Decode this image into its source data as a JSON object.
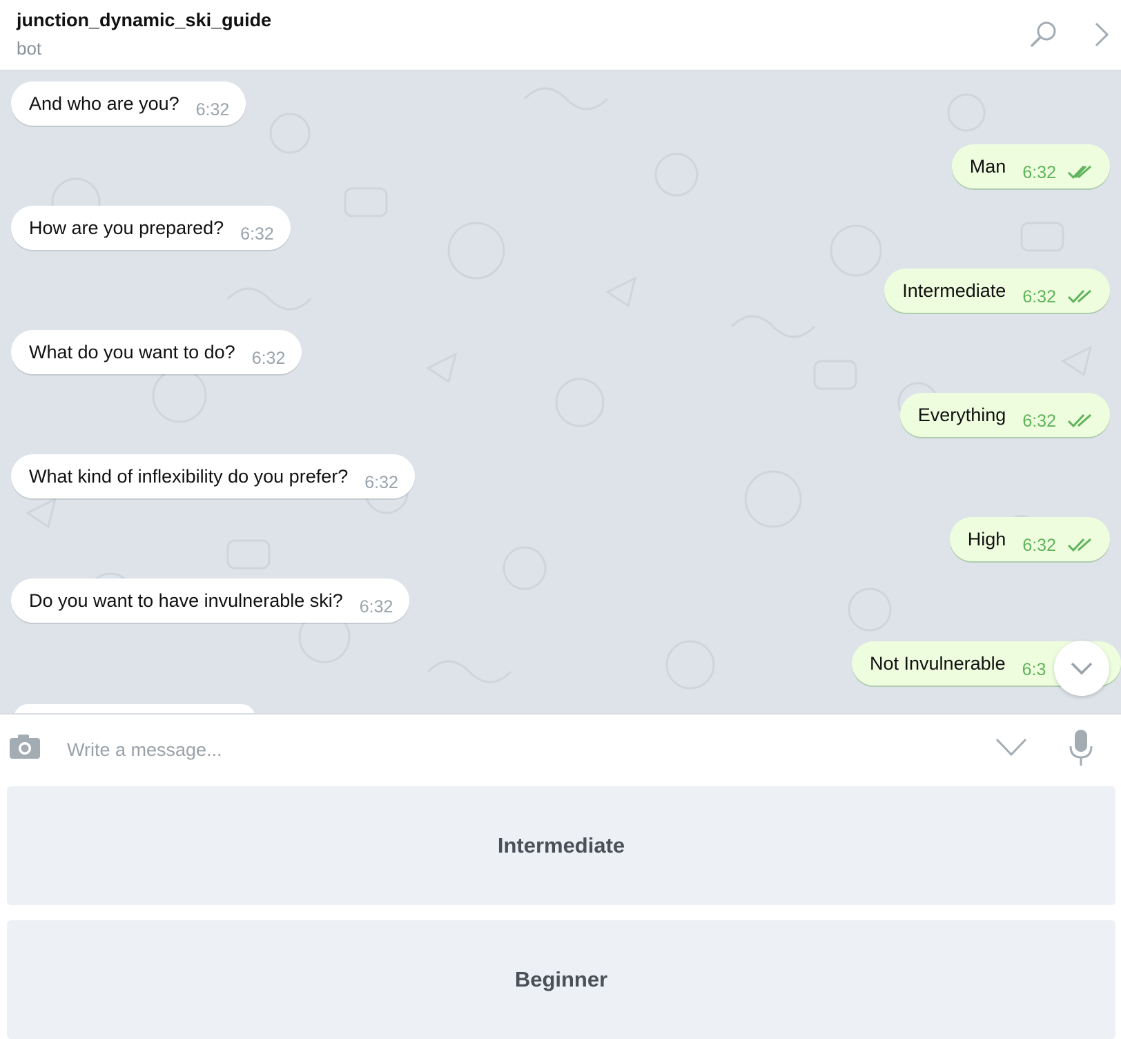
{
  "header": {
    "title": "junction_dynamic_ski_guide",
    "subtitle": "bot",
    "search_icon": "search-icon",
    "more_icon": "chevron-right-icon"
  },
  "messages": [
    {
      "direction": "in",
      "text": "And who are you?",
      "time": "6:32"
    },
    {
      "direction": "out",
      "text": "Man",
      "time": "6:32",
      "status": "read"
    },
    {
      "direction": "in",
      "text": "How are you prepared?",
      "time": "6:32"
    },
    {
      "direction": "out",
      "text": "Intermediate",
      "time": "6:32",
      "status": "read"
    },
    {
      "direction": "in",
      "text": "What do you want to do?",
      "time": "6:32"
    },
    {
      "direction": "out",
      "text": "Everything",
      "time": "6:32",
      "status": "read"
    },
    {
      "direction": "in",
      "text": "What kind of inflexibility do you prefer?",
      "time": "6:32"
    },
    {
      "direction": "out",
      "text": "High",
      "time": "6:32",
      "status": "read"
    },
    {
      "direction": "in",
      "text": "Do you want to have invulnerable ski?",
      "time": "6:32"
    },
    {
      "direction": "out",
      "text": "Not Invulnerable",
      "time": "6:3",
      "status": "read"
    }
  ],
  "composer": {
    "placeholder": "Write a message...",
    "camera_icon": "camera-icon",
    "keyboard_toggle_icon": "chevron-down-icon",
    "mic_icon": "microphone-icon"
  },
  "keyboard": {
    "buttons": [
      "Intermediate",
      "Beginner"
    ]
  },
  "colors": {
    "chat_background": "#dde3e9",
    "outgoing_bubble": "#effddf",
    "incoming_bubble": "#ffffff",
    "outgoing_time": "#5fb35a",
    "keyboard_button": "#edf0f4"
  }
}
